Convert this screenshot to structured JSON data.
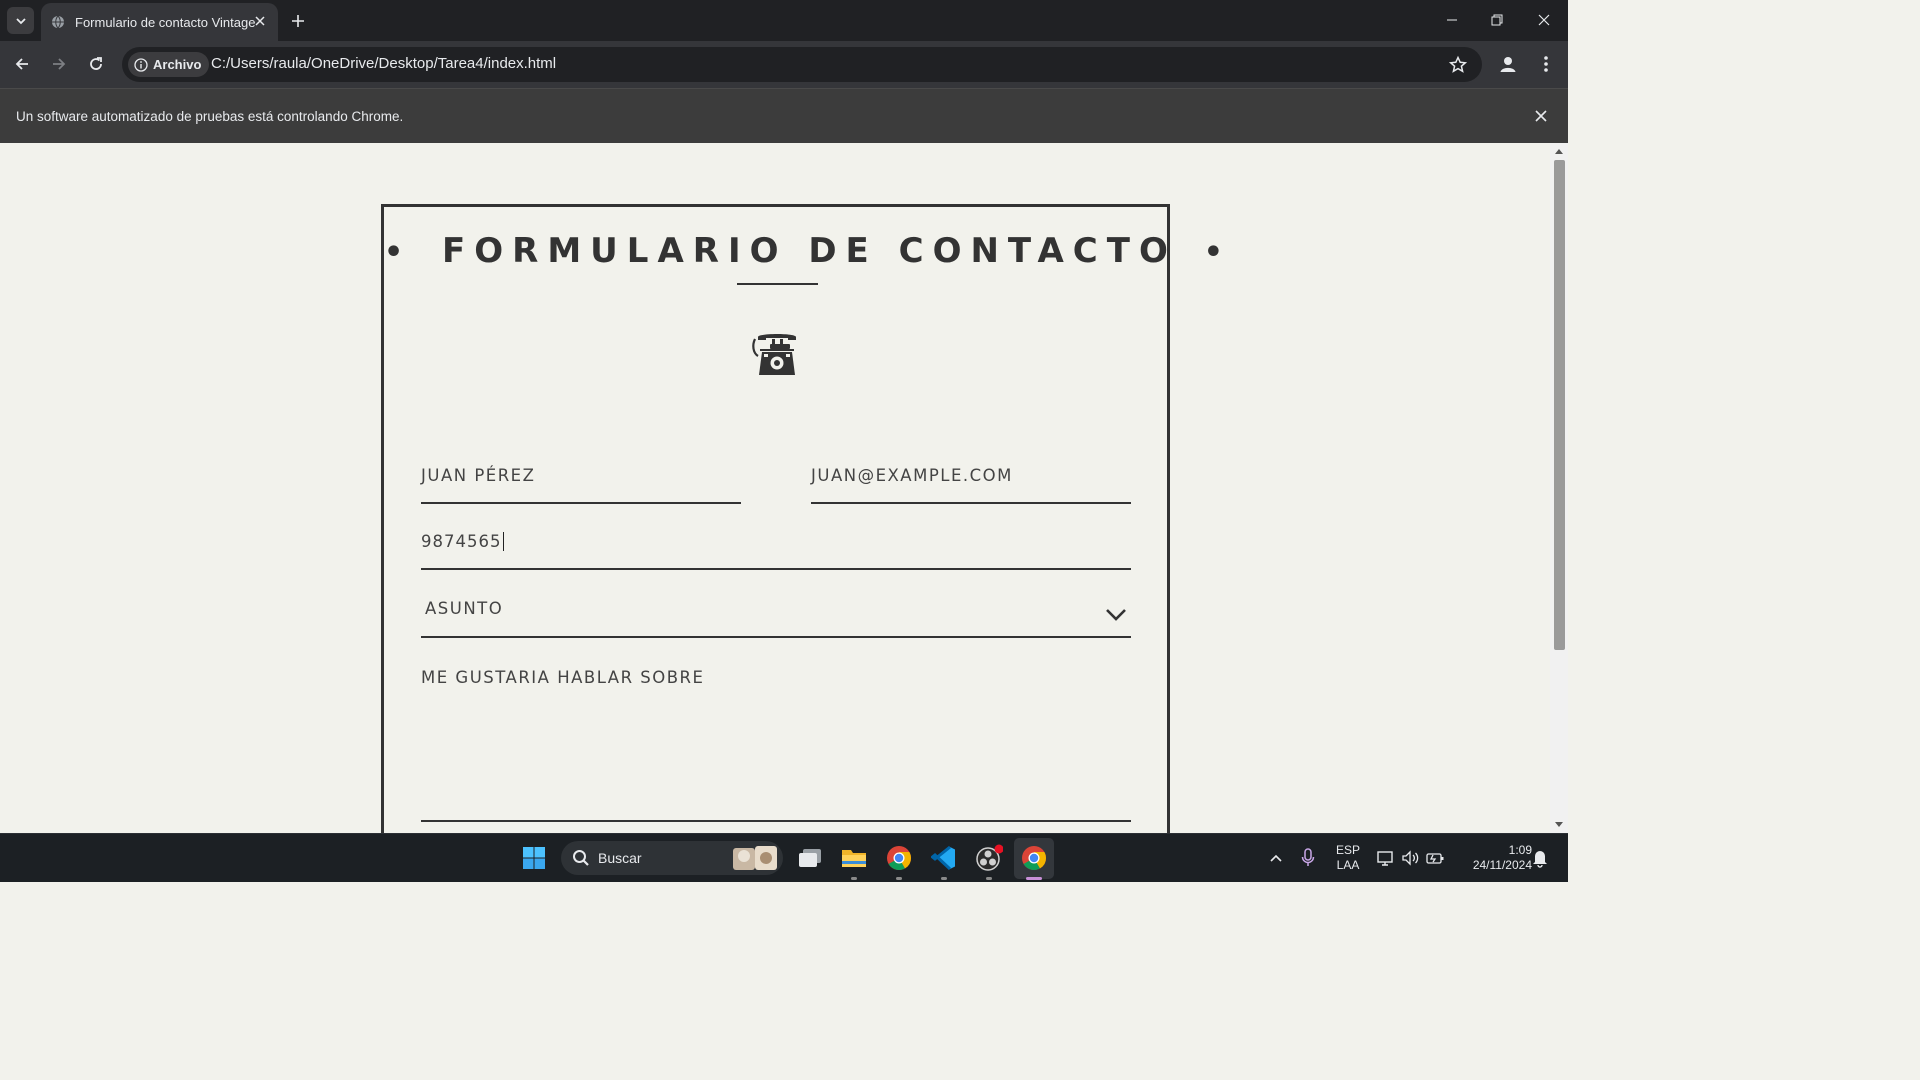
{
  "browser": {
    "tab_title": "Formulario de contacto Vintage",
    "site_chip": "Archivo",
    "url": "C:/Users/raula/OneDrive/Desktop/Tarea4/index.html",
    "infobar_message": "Un software automatizado de pruebas está controlando Chrome."
  },
  "form": {
    "title": "FORMULARIO DE CONTACTO",
    "title_bullet": "•",
    "name_placeholder": "JUAN PÉREZ",
    "email_placeholder": "JUAN@EXAMPLE.COM",
    "phone_value": "9874565",
    "subject_selected": "ASUNTO",
    "message_placeholder": "ME GUSTARIA HABLAR SOBRE"
  },
  "taskbar": {
    "search_label": "Buscar",
    "lang_top": "ESP",
    "lang_bottom": "LAA",
    "time": "1:09",
    "date": "24/11/2024"
  },
  "icons": [
    "chevron-down-icon",
    "globe-icon",
    "close-icon",
    "plus-icon",
    "minimize-icon",
    "restore-icon",
    "back-icon",
    "forward-icon",
    "reload-icon",
    "info-icon",
    "star-icon",
    "profile-icon",
    "menu-icon",
    "telephone-icon",
    "windows-icon",
    "search-icon",
    "file-explorer-icon",
    "chrome-icon",
    "vscode-icon",
    "microphone-icon",
    "volume-icon",
    "network-icon",
    "battery-icon",
    "notification-icon"
  ]
}
